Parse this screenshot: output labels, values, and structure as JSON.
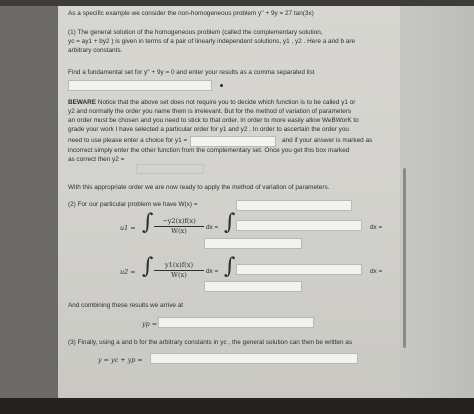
{
  "intro": "As a specific example we consider the non-homogeneous problem y'' + 9y = 27 tan(3x)",
  "part1": {
    "line1": "(1) The general solution of the homogeneous problem (called the complementary solution,",
    "line2": "yc = ay1 + by2 ) is given in terms of a pair of linearly independent solutions, y1 , y2 . Here a and b are",
    "line3": "arbitrary constants.",
    "prompt": "Find a fundamental set for y'' + 9y = 0 and enter your results as a comma separated list",
    "field_value": ""
  },
  "beware": {
    "label": "BEWARE",
    "line1": "Notice that the above set does not require you to decide which function is to be called y1 or",
    "line2": "y2 and normally the order you name them is irrelevant. But for the method of variation of parameters",
    "line3": "an order must be chosen and you need to stick to that order. In order to more easily allow WeBWorK to",
    "line4": "grade your work I have selected a particular order for y1 and y2 . In order to ascertain the order you",
    "line5a": "need to use please enter a choice for y1 =",
    "line5b": "and if your answer is marked as",
    "line6": "incorrect simply enter the other function from the complementary set. Once you get this box marked",
    "line7": "as correct then y2 =",
    "y1_value": ""
  },
  "order_text": "With this appropriate order we are now ready to apply the method of variation of parameters.",
  "part2": {
    "prompt": "(2) For our particular problem we have W(x) =",
    "u1_label": "u1 =",
    "u1_num": "−y2(x)f(x)",
    "u1_den": "W(x)",
    "u2_label": "u2 =",
    "u2_num": "y1(x)f(x)",
    "u2_den": "W(x)",
    "dx": "dx =",
    "dx_end": "dx =",
    "combine": "And combining these results we arrive at",
    "yp_label": "yp ="
  },
  "part3": {
    "prompt": "(3) Finally, using a and b for the arbitrary constants in yc , the general solution can then be written as",
    "y_label": "y = yc + yp ="
  }
}
